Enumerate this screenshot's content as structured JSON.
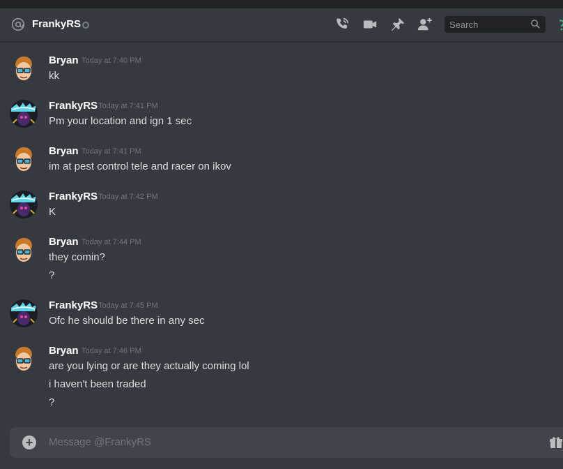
{
  "header": {
    "username": "FrankyRS",
    "search_placeholder": "Search"
  },
  "icons": {
    "at": "at-icon",
    "status": "status-dot-offline",
    "call": "phone-call-icon",
    "video": "video-camera-icon",
    "pin": "pin-icon",
    "add_friend": "add-friend-icon",
    "search": "search-icon",
    "gift": "gift-icon",
    "attach": "plus-circle-icon"
  },
  "messages": [
    {
      "author": "Bryan",
      "timestamp": "Today at 7:40 PM",
      "lines": [
        "kk"
      ]
    },
    {
      "author": "FrankyRS",
      "timestamp": "Today at 7:41 PM",
      "lines": [
        "Pm your location and ign 1 sec"
      ]
    },
    {
      "author": "Bryan",
      "timestamp": "Today at 7:41 PM",
      "lines": [
        "im at pest control tele and racer on ikov"
      ]
    },
    {
      "author": "FrankyRS",
      "timestamp": "Today at 7:42 PM",
      "lines": [
        "K"
      ]
    },
    {
      "author": "Bryan",
      "timestamp": "Today at 7:44 PM",
      "lines": [
        "they comin?",
        "?"
      ]
    },
    {
      "author": "FrankyRS",
      "timestamp": "Today at 7:45 PM",
      "lines": [
        "Ofc he should be there in any sec"
      ]
    },
    {
      "author": "Bryan",
      "timestamp": "Today at 7:46 PM",
      "lines": [
        "are you lying or are they actually coming lol",
        "i haven't been traded",
        "?"
      ]
    }
  ],
  "composer": {
    "placeholder": "Message @FrankyRS"
  },
  "colors": {
    "background": "#36393f",
    "header_text": "#ffffff",
    "message_text": "#dcddde",
    "timestamp": "#72767d",
    "composer_bg": "#40444b",
    "search_bg": "#202225"
  }
}
